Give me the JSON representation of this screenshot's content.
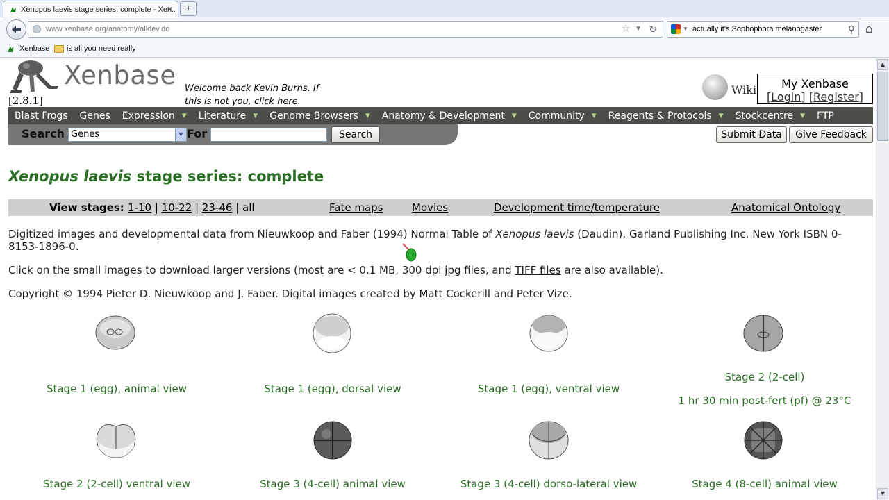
{
  "browser": {
    "tab_title": "Xenopus laevis stage series: complete - Xen...",
    "tab_close": "×",
    "new_tab": "+",
    "url_host": "www.xenbase.org",
    "url_path": "/anatomy/alldev.do",
    "search_text": "actually it's Sophophora melanogaster",
    "bookmarks": [
      {
        "label": "Xenbase"
      },
      {
        "label": "is all you need really"
      }
    ]
  },
  "header": {
    "logo_text": "Xenbase",
    "version": "[2.8.1]",
    "welcome_prefix": "Welcome back ",
    "welcome_user": "Kevin Burns",
    "welcome_mid": ". If",
    "welcome_line2_prefix": "this is not you, ",
    "welcome_click": "click here",
    "welcome_end": ".",
    "wiki": "Wiki",
    "myxenbase_title": "My Xenbase",
    "login": "[Login]",
    "register": "[Register]"
  },
  "menu": [
    {
      "label": "Blast Frogs",
      "dropdown": false
    },
    {
      "label": "Genes",
      "dropdown": false
    },
    {
      "label": "Expression",
      "dropdown": true
    },
    {
      "label": "Literature",
      "dropdown": true
    },
    {
      "label": "Genome Browsers",
      "dropdown": true
    },
    {
      "label": "Anatomy & Development",
      "dropdown": true
    },
    {
      "label": "Community",
      "dropdown": true
    },
    {
      "label": "Reagents & Protocols",
      "dropdown": true
    },
    {
      "label": "Stockcentre",
      "dropdown": true
    },
    {
      "label": "FTP",
      "dropdown": false
    }
  ],
  "search": {
    "label": "Search",
    "selected": "Genes",
    "for_label": "For",
    "value": "",
    "button": "Search"
  },
  "actions": {
    "submit": "Submit Data",
    "feedback": "Give Feedback"
  },
  "page": {
    "title_italic": "Xenopus laevis",
    "title_rest": " stage series: complete",
    "view_label": "View stages: ",
    "stages_1": "1-10",
    "sep": " | ",
    "stages_2": "10-22",
    "stages_3": "23-46",
    "stages_all": "all",
    "fate_maps": "Fate maps",
    "movies": "Movies",
    "dev_time": "Development time/temperature",
    "ontology": "Anatomical Ontology",
    "para1_a": "Digitized images and developmental data from Nieuwkoop and Faber (1994) Normal Table of ",
    "para1_italic": "Xenopus laevis",
    "para1_b": " (Daudin). Garland Publishing Inc, New York ISBN 0-8153-1896-0.",
    "para2_a": "Click on the small images to download larger versions (most are < 0.1 MB, 300 dpi jpg files, and ",
    "para2_link": "TIFF files",
    "para2_b": " are also available).",
    "para3": "Copyright © 1994 Pieter D. Nieuwkoop and J. Faber. Digital images created by Matt Cockerill and Peter Vize."
  },
  "stages": [
    {
      "caption": "Stage 1 (egg), animal view"
    },
    {
      "caption": "Stage 1 (egg), dorsal view"
    },
    {
      "caption": "Stage 1 (egg), ventral view"
    },
    {
      "caption": "Stage 2 (2-cell)",
      "subcaption": "1 hr 30 min post-fert (pf) @ 23°C"
    },
    {
      "caption": "Stage 2 (2-cell) ventral view"
    },
    {
      "caption": "Stage 3 (4-cell) animal view"
    },
    {
      "caption": "Stage 3 (4-cell) dorso-lateral view"
    },
    {
      "caption": "Stage 4 (8-cell) animal view"
    }
  ]
}
